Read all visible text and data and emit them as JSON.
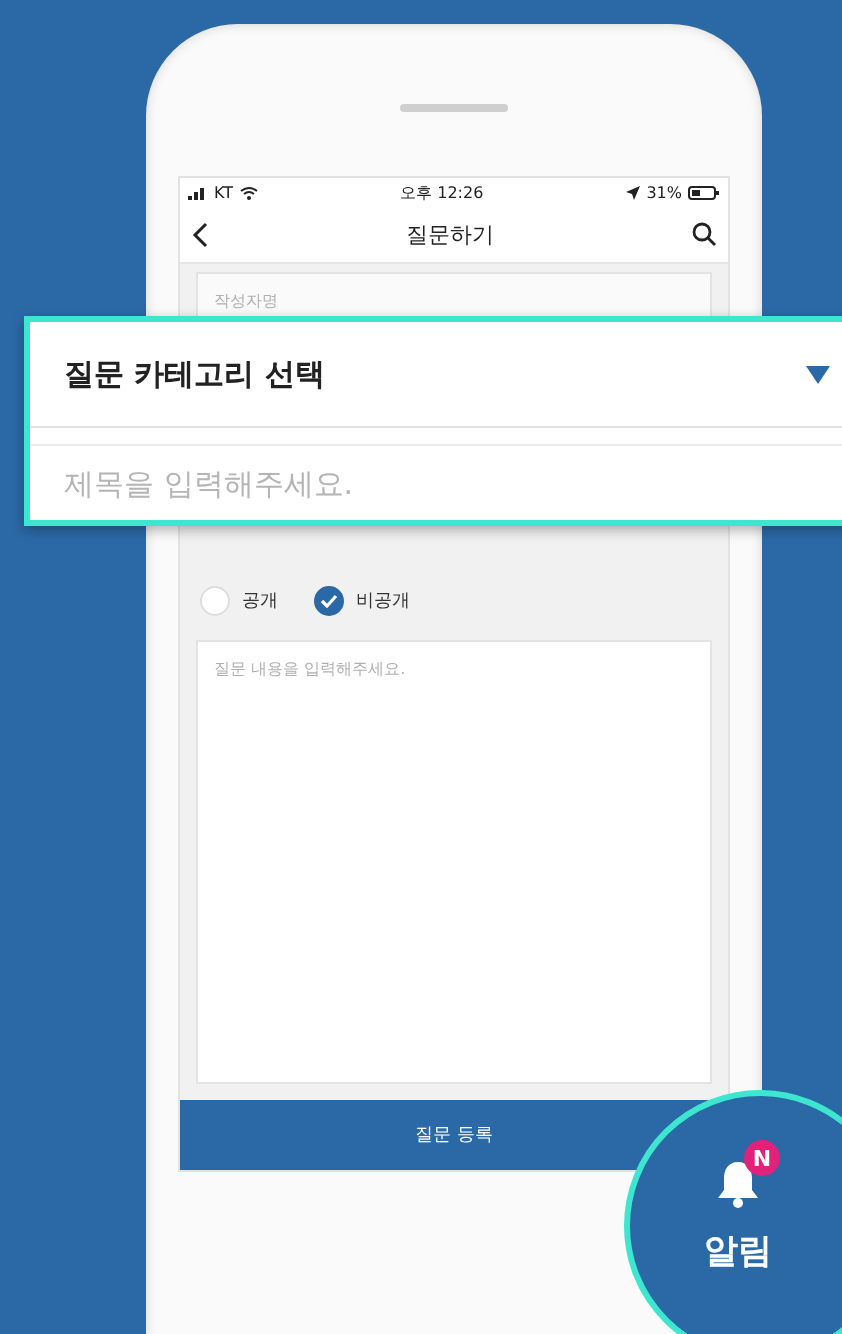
{
  "status_bar": {
    "carrier": "KT",
    "time": "오후 12:26",
    "battery": "31%"
  },
  "nav": {
    "title": "질문하기"
  },
  "form": {
    "author": {
      "placeholder": "작성자명"
    },
    "visibility": [
      {
        "label": "공개",
        "selected": false
      },
      {
        "label": "비공개",
        "selected": true
      }
    ],
    "content": {
      "placeholder": "질문 내용을 입력해주세요."
    },
    "submit": "질문 등록"
  },
  "callout": {
    "category": "질문 카테고리 선택",
    "title": {
      "placeholder": "제목을 입력해주세요."
    }
  },
  "notification_button": {
    "label": "알림",
    "badge": "N"
  }
}
